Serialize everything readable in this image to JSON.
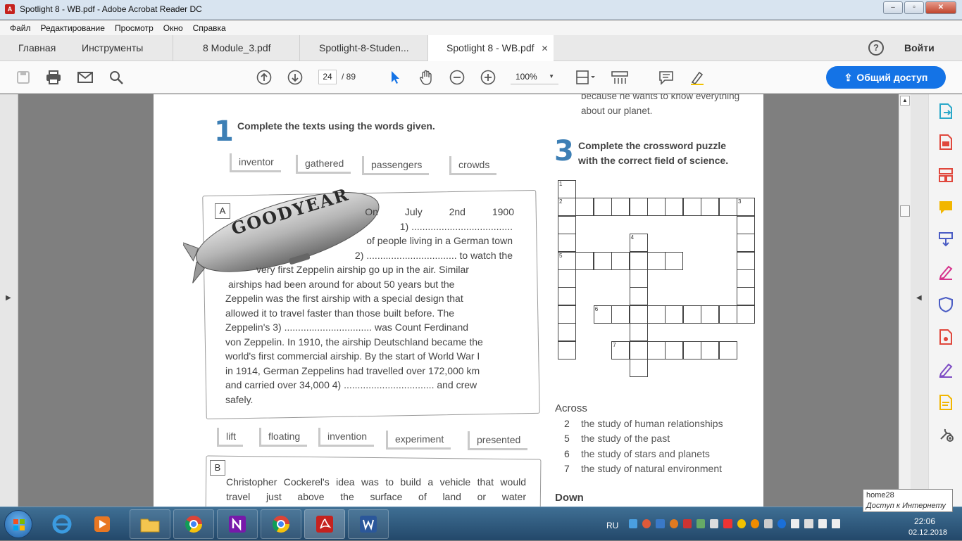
{
  "window": {
    "title": "Spotlight 8 - WB.pdf - Adobe Acrobat Reader DC",
    "buttons": [
      "–",
      "▫",
      "✕"
    ]
  },
  "menu": [
    "Файл",
    "Редактирование",
    "Просмотр",
    "Окно",
    "Справка"
  ],
  "tabs": {
    "home": "Главная",
    "tools": "Инструменты",
    "doc1": "8 Module_3.pdf",
    "doc2": "Spotlight-8-Studen...",
    "doc3": "Spotlight 8 - WB.pdf",
    "close": "✕"
  },
  "header": {
    "help": "?",
    "signin": "Войти"
  },
  "toolbar": {
    "page_current": "24",
    "page_total": "/ 89",
    "zoom": "100%",
    "share": "Общий доступ"
  },
  "doc": {
    "top_fragment": [
      "because he wants to know everything",
      "about our planet."
    ],
    "ex1_num": "1",
    "ex1_title": "Complete the texts using the words given.",
    "words1": [
      "inventor",
      "gathered",
      "passengers",
      "crowds"
    ],
    "box_a": "A",
    "blimp_text": "GOODYEAR",
    "text_a": [
      "On July 2nd 1900",
      "1) .....................................",
      "of people living in a German town",
      "2) ................................. to watch the",
      "very first Zeppelin airship go up in the air. Similar",
      "airships had been around for about 50 years but the",
      "Zeppelin was the first airship with a special design that",
      "allowed it to travel faster than those built before. The",
      "Zeppelin's 3) ................................ was Count Ferdinand",
      "von Zeppelin. In 1910, the airship Deutschland became the",
      "world's first commercial airship. By the start of World War I",
      "in 1914, German Zeppelins had travelled over 172,000 km",
      "and carried over 34,000 4) ................................. and crew",
      "safely."
    ],
    "words2": [
      "lift",
      "floating",
      "invention",
      "experiment",
      "presented"
    ],
    "box_b": "B",
    "text_b": [
      "Christopher Cockerel's idea was to build a vehicle that would",
      "travel just above the surface of land or water"
    ],
    "ex3_num": "3",
    "ex3_title": [
      "Complete the crossword puzzle",
      "with the correct field of science."
    ],
    "across_label": "Across",
    "across": [
      {
        "n": "2",
        "text": "the study of human relationships"
      },
      {
        "n": "5",
        "text": "the study of the past"
      },
      {
        "n": "6",
        "text": "the study of stars and planets"
      },
      {
        "n": "7",
        "text": "the study of natural environment"
      }
    ],
    "down_label": "Down",
    "crossword_numbers": [
      "1",
      "2",
      "3",
      "4",
      "5",
      "6",
      "7"
    ]
  },
  "taskbar": {
    "lang": "RU",
    "time": "22:06",
    "date": "02.12.2018"
  },
  "tooltip": {
    "line1": "home28",
    "line2": "Доступ к Интернету"
  },
  "colors": {
    "accent": "#1473e6",
    "exercise_blue": "#3d7fb5",
    "acrobat_red": "#c5221f"
  }
}
